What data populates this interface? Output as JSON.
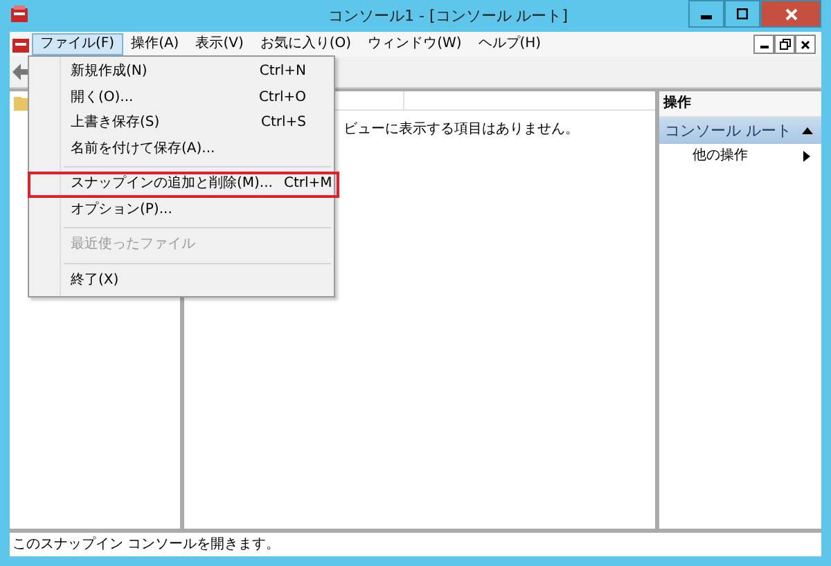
{
  "window": {
    "title": "コンソール1 - [コンソール ルート]"
  },
  "menu_bar": [
    {
      "label": "ファイル(F)",
      "selected": true
    },
    {
      "label": "操作(A)",
      "selected": false
    },
    {
      "label": "表示(V)",
      "selected": false
    },
    {
      "label": "お気に入り(O)",
      "selected": false
    },
    {
      "label": "ウィンドウ(W)",
      "selected": false
    },
    {
      "label": "ヘルプ(H)",
      "selected": false
    }
  ],
  "file_menu": [
    {
      "kind": "item",
      "label": "新規作成(N)",
      "shortcut": "Ctrl+N",
      "disabled": false,
      "highlighted": false
    },
    {
      "kind": "item",
      "label": "開く(O)...",
      "shortcut": "Ctrl+O",
      "disabled": false,
      "highlighted": false
    },
    {
      "kind": "item",
      "label": "上書き保存(S)",
      "shortcut": "Ctrl+S",
      "disabled": false,
      "highlighted": false
    },
    {
      "kind": "item",
      "label": "名前を付けて保存(A)...",
      "disabled": false,
      "highlighted": false
    },
    {
      "kind": "separator"
    },
    {
      "kind": "item",
      "label": "スナップインの追加と削除(M)...",
      "shortcut": "Ctrl+M",
      "disabled": false,
      "highlighted": true
    },
    {
      "kind": "item",
      "label": "オプション(P)...",
      "disabled": false,
      "highlighted": false
    },
    {
      "kind": "separator"
    },
    {
      "kind": "item",
      "label": "最近使ったファイル",
      "disabled": true,
      "highlighted": false
    },
    {
      "kind": "separator"
    },
    {
      "kind": "item",
      "label": "終了(X)",
      "disabled": false,
      "highlighted": false
    }
  ],
  "content": {
    "message": "ビューに表示する項目はありません。"
  },
  "actions_pane": {
    "header": "操作",
    "section": "コンソール ルート",
    "items": [
      "他の操作"
    ]
  },
  "status_bar": "このスナップイン コンソールを開きます。"
}
